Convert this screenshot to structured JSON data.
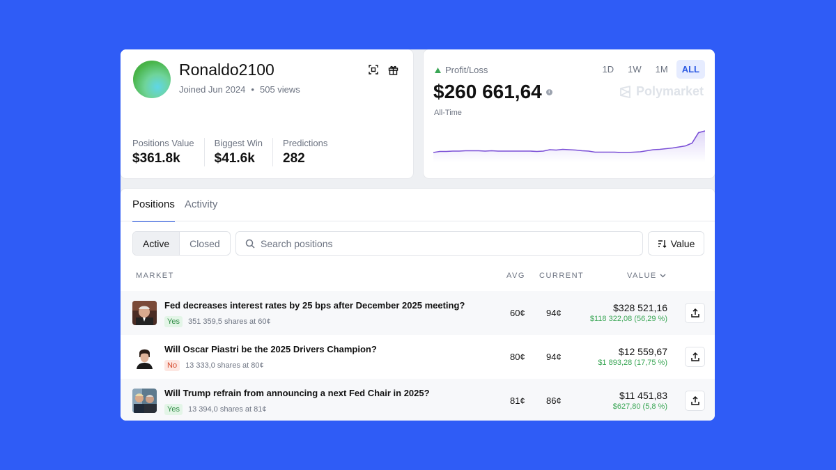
{
  "colors": {
    "background": "#2f5cf6",
    "accent": "#2d5be3",
    "positive": "#3aa655",
    "chart_line": "#7a4fd6"
  },
  "profile": {
    "username": "Ronaldo2100",
    "joined": "Joined Jun 2024",
    "views": "505 views",
    "stats": [
      {
        "label": "Positions Value",
        "value": "$361.8k"
      },
      {
        "label": "Biggest Win",
        "value": "$41.6k"
      },
      {
        "label": "Predictions",
        "value": "282"
      }
    ]
  },
  "pnl": {
    "label": "Profit/Loss",
    "value": "$260 661,64",
    "period": "All-Time",
    "ranges": [
      "1D",
      "1W",
      "1M",
      "ALL"
    ],
    "active_range": "ALL",
    "brand": "Polymarket",
    "chart_data": {
      "type": "line",
      "y": [
        0.28,
        0.31,
        0.31,
        0.32,
        0.32,
        0.33,
        0.33,
        0.33,
        0.32,
        0.33,
        0.32,
        0.32,
        0.32,
        0.32,
        0.32,
        0.32,
        0.31,
        0.32,
        0.36,
        0.35,
        0.37,
        0.36,
        0.35,
        0.33,
        0.32,
        0.29,
        0.29,
        0.29,
        0.29,
        0.28,
        0.28,
        0.29,
        0.3,
        0.33,
        0.36,
        0.37,
        0.39,
        0.41,
        0.44,
        0.47,
        0.55,
        0.85,
        0.9
      ]
    }
  },
  "tabs": [
    "Positions",
    "Activity"
  ],
  "filters": {
    "segments": [
      "Active",
      "Closed"
    ],
    "search_placeholder": "Search positions",
    "sort_label": "Value"
  },
  "table": {
    "headers": {
      "market": "MARKET",
      "avg": "AVG",
      "current": "CURRENT",
      "value": "VALUE"
    },
    "rows": [
      {
        "title": "Fed decreases interest rates by 25 bps after December 2025 meeting?",
        "outcome": "Yes",
        "shares": "351 359,5 shares at 60¢",
        "avg": "60¢",
        "current": "94¢",
        "value": "$328 521,16",
        "pnl": "$118 322,08 (56,29 %)"
      },
      {
        "title": "Will Oscar Piastri be the 2025 Drivers Champion?",
        "outcome": "No",
        "shares": "13 333,0 shares at 80¢",
        "avg": "80¢",
        "current": "94¢",
        "value": "$12 559,67",
        "pnl": "$1 893,28 (17,75 %)"
      },
      {
        "title": "Will Trump refrain from announcing a next Fed Chair in 2025?",
        "outcome": "Yes",
        "shares": "13 394,0 shares at 81¢",
        "avg": "81¢",
        "current": "86¢",
        "value": "$11 451,83",
        "pnl": "$627,80 (5,8 %)"
      }
    ]
  }
}
